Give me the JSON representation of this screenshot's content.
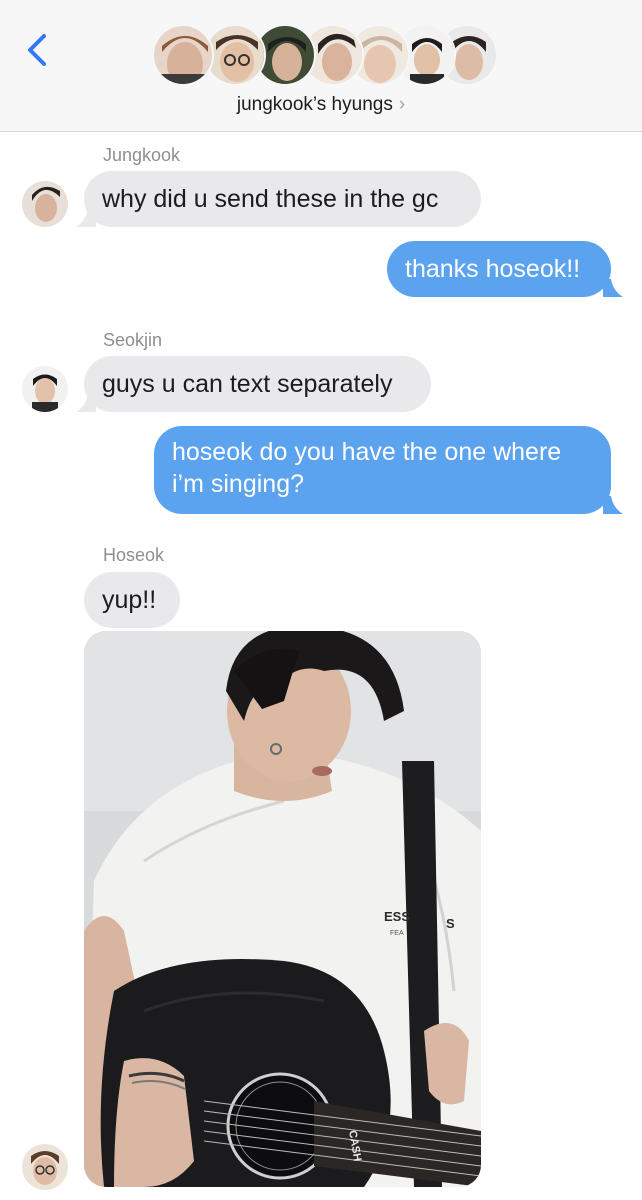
{
  "header": {
    "back_icon": "chevron-left-icon",
    "group_name": "jungkook’s hyungs",
    "chevron": "›",
    "accent_color": "#3478f6",
    "member_avatars": [
      {
        "tone": "#b98c76"
      },
      {
        "tone": "#c9a489"
      },
      {
        "tone": "#4d5b3e"
      },
      {
        "tone": "#8a6a55"
      },
      {
        "tone": "#d9c2ad"
      },
      {
        "tone": "#2d2a2a"
      },
      {
        "tone": "#c8b6a6"
      }
    ]
  },
  "messages": [
    {
      "sender": "Jungkook",
      "text": "why did u send these in the gc",
      "direction": "incoming"
    },
    {
      "text": "thanks hoseok!!",
      "direction": "outgoing"
    },
    {
      "sender": "Seokjin",
      "text": "guys u can text separately",
      "direction": "incoming"
    },
    {
      "text_line1": "hoseok do you have the one where",
      "text_line2": "i’m singing?",
      "direction": "outgoing"
    },
    {
      "sender": "Hoseok",
      "text": "yup!!",
      "direction": "incoming"
    }
  ],
  "photo": {
    "shirt_text_left": "ESS",
    "shirt_text_right": "S",
    "shirt_text_small": "FEA",
    "guitar_text": "CASH"
  },
  "colors": {
    "incoming_bubble": "#e9e9eb",
    "outgoing_bubble": "#5ba3ee",
    "sender_label": "#8e8e93"
  }
}
